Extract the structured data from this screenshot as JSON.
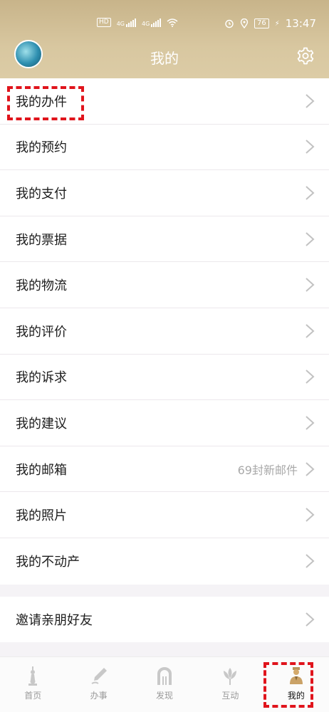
{
  "status_bar": {
    "hd": "HD",
    "net1": "4G",
    "net2": "4G",
    "battery": "76",
    "time": "13:47"
  },
  "header": {
    "title": "我的"
  },
  "menu": {
    "items": [
      {
        "label": "我的办件"
      },
      {
        "label": "我的预约"
      },
      {
        "label": "我的支付"
      },
      {
        "label": "我的票据"
      },
      {
        "label": "我的物流"
      },
      {
        "label": "我的评价"
      },
      {
        "label": "我的诉求"
      },
      {
        "label": "我的建议"
      },
      {
        "label": "我的邮箱",
        "extra": "69封新邮件"
      },
      {
        "label": "我的照片"
      },
      {
        "label": "我的不动产"
      }
    ]
  },
  "invite": {
    "label": "邀请亲朋好友"
  },
  "tabbar": {
    "tabs": [
      {
        "label": "首页",
        "icon": "tower-icon"
      },
      {
        "label": "办事",
        "icon": "pen-icon"
      },
      {
        "label": "发现",
        "icon": "arch-icon"
      },
      {
        "label": "互动",
        "icon": "tulip-icon"
      },
      {
        "label": "我的",
        "icon": "person-icon",
        "active": true
      }
    ]
  },
  "colors": {
    "accent": "#c8b48a",
    "highlight": "#e0141c"
  }
}
